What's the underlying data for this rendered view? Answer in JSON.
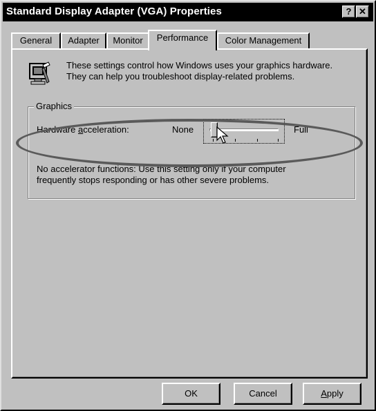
{
  "window": {
    "title": "Standard Display Adapter (VGA) Properties",
    "help_label": "?",
    "close_label": "✕"
  },
  "tabs": [
    {
      "label": "General",
      "active": false
    },
    {
      "label": "Adapter",
      "active": false
    },
    {
      "label": "Monitor",
      "active": false
    },
    {
      "label": "Performance",
      "active": true
    },
    {
      "label": "Color Management",
      "active": false
    }
  ],
  "info": {
    "text_line1": "These settings control how Windows uses your graphics hardware.",
    "text_line2": "They can help you troubleshoot display-related problems.",
    "icon": "monitor-settings-icon"
  },
  "graphics_group": {
    "label": "Graphics",
    "hw_accel_label_pre": "Hardware ",
    "hw_accel_label_accel": "a",
    "hw_accel_label_post": "cceleration:",
    "min_label": "None",
    "max_label": "Full",
    "slider_level": 0,
    "slider_positions": 4,
    "description_line1": "No accelerator functions: Use this setting only if your computer",
    "description_line2": "frequently stops responding or has other severe problems."
  },
  "buttons": {
    "ok": "OK",
    "cancel": "Cancel",
    "apply_underlined": "A",
    "apply_rest": "pply"
  },
  "annotation": {
    "highlight_color": "#5a5a5a"
  }
}
